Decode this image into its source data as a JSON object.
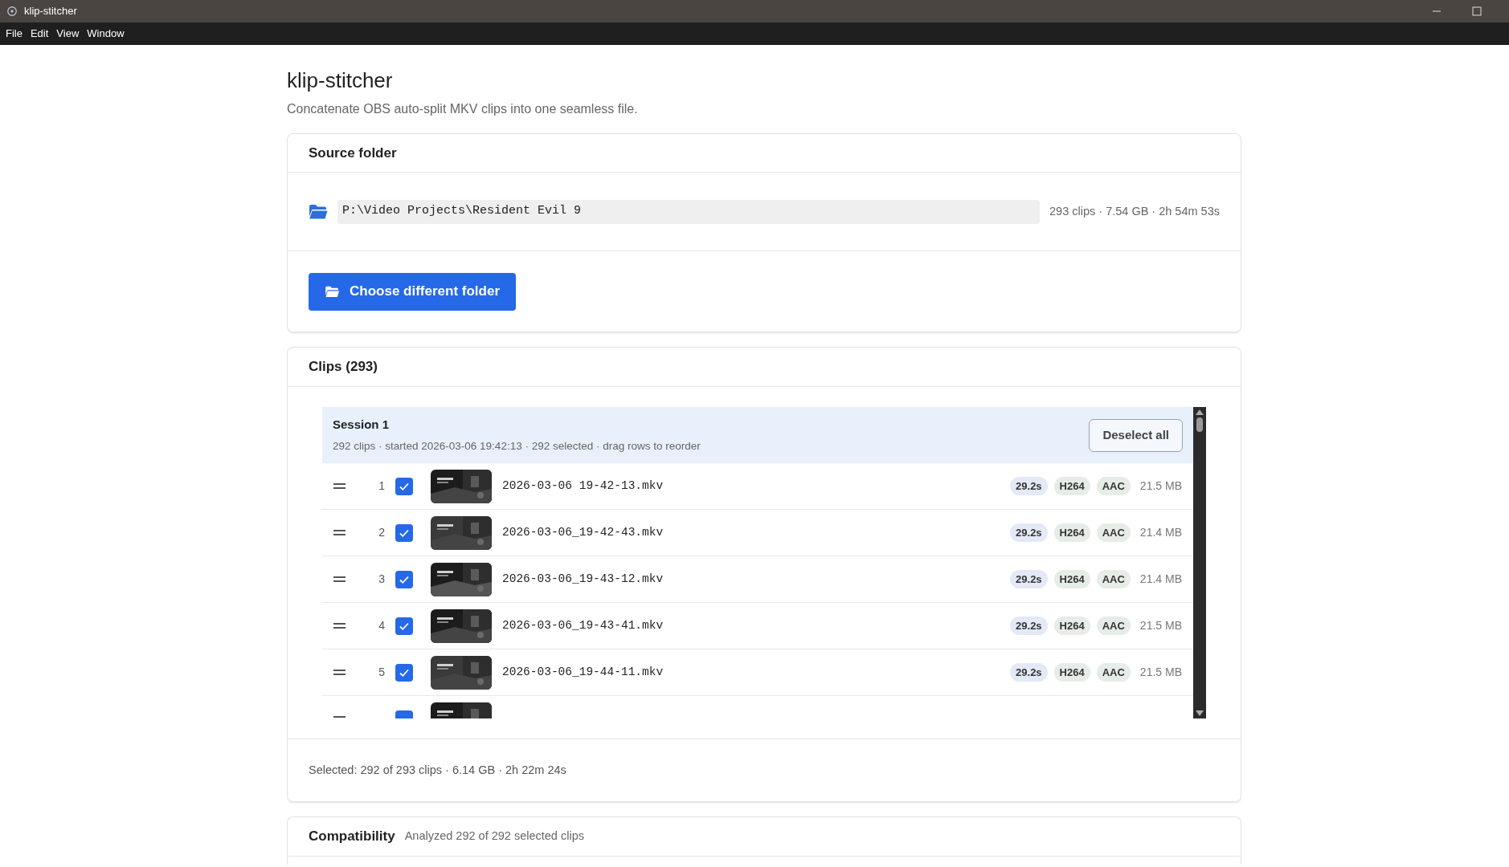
{
  "window": {
    "title": "klip-stitcher"
  },
  "menu": [
    "File",
    "Edit",
    "View",
    "Window"
  ],
  "header": {
    "title": "klip-stitcher",
    "subtitle": "Concatenate OBS auto-split MKV clips into one seamless file."
  },
  "source_folder": {
    "title": "Source folder",
    "path": "P:\\Video Projects\\Resident Evil 9",
    "summary": "293 clips · 7.54 GB · 2h 54m 53s",
    "button": "Choose different folder"
  },
  "clips": {
    "title": "Clips (293)",
    "session": {
      "title": "Session 1",
      "summary": "292 clips · started 2026-03-06 19:42:13 · 292 selected · drag rows to reorder",
      "button": "Deselect all"
    },
    "rows": [
      {
        "index": "1",
        "checked": true,
        "filename": "2026-03-06 19-42-13.mkv",
        "duration": "29.2s",
        "video": "H264",
        "audio": "AAC",
        "size": "21.5 MB"
      },
      {
        "index": "2",
        "checked": true,
        "filename": "2026-03-06_19-42-43.mkv",
        "duration": "29.2s",
        "video": "H264",
        "audio": "AAC",
        "size": "21.4 MB"
      },
      {
        "index": "3",
        "checked": true,
        "filename": "2026-03-06_19-43-12.mkv",
        "duration": "29.2s",
        "video": "H264",
        "audio": "AAC",
        "size": "21.4 MB"
      },
      {
        "index": "4",
        "checked": true,
        "filename": "2026-03-06_19-43-41.mkv",
        "duration": "29.2s",
        "video": "H264",
        "audio": "AAC",
        "size": "21.5 MB"
      },
      {
        "index": "5",
        "checked": true,
        "filename": "2026-03-06_19-44-11.mkv",
        "duration": "29.2s",
        "video": "H264",
        "audio": "AAC",
        "size": "21.5 MB"
      },
      {
        "checked": true
      }
    ],
    "footer": "Selected: 292 of 293 clips · 6.14 GB · 2h 22m 24s"
  },
  "compatibility": {
    "title": "Compatibility",
    "summary": "Analyzed 292 of 292 selected clips"
  }
}
